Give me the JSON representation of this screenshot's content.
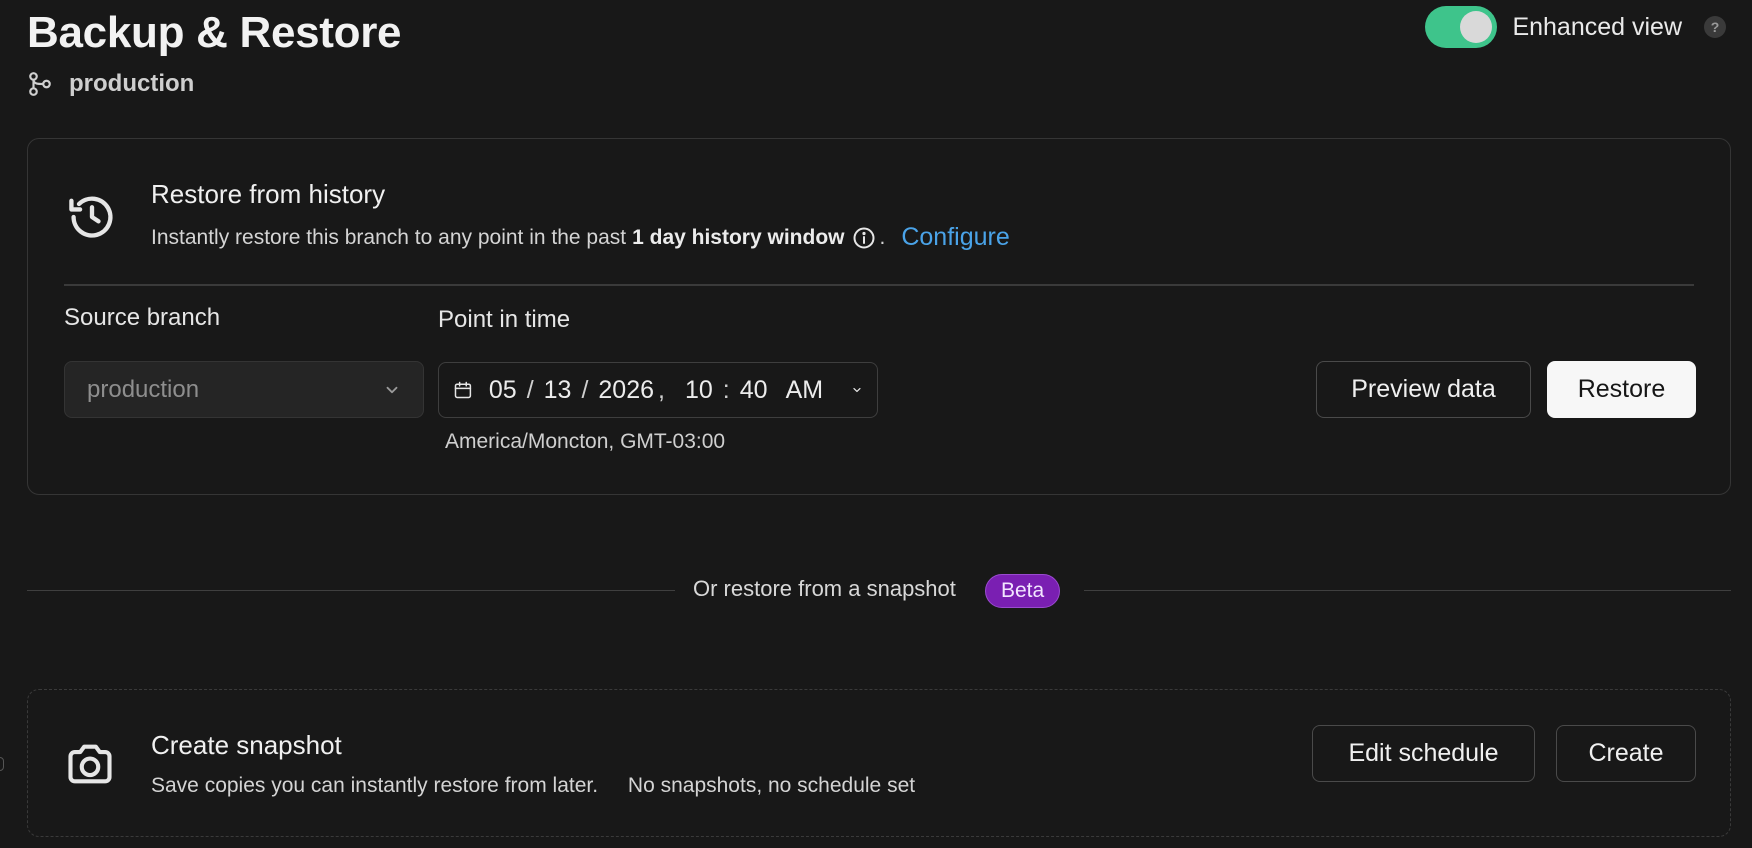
{
  "header": {
    "title": "Backup & Restore",
    "branch": "production",
    "enhanced_view_label": "Enhanced view",
    "enhanced_view_on": true,
    "help_glyph": "?",
    "toggle_color": "#3ec48b"
  },
  "history": {
    "title": "Restore from history",
    "description": "Instantly restore this branch to any point in the past",
    "window_text": "1 day history window",
    "period": ".",
    "configure_label": "Configure",
    "source_branch_label": "Source branch",
    "source_branch_value": "production",
    "point_in_time_label": "Point in time",
    "date": {
      "month": "05",
      "day": "13",
      "year": "2026",
      "hour": "10",
      "minute": "40",
      "ampm": "AM",
      "date_sep": "/",
      "date_time_sep": ",",
      "time_sep": ":"
    },
    "timezone": "America/Moncton, GMT-03:00",
    "preview_label": "Preview data",
    "restore_label": "Restore"
  },
  "snapshot_divider": {
    "text": "Or restore from a snapshot",
    "badge": "Beta",
    "badge_color": "#7a1fb2"
  },
  "snapshot": {
    "title": "Create snapshot",
    "description": "Save copies you can instantly restore from later.",
    "status": "No snapshots, no schedule set",
    "edit_schedule_label": "Edit schedule",
    "create_label": "Create"
  },
  "icons": {
    "branch": "branch-icon",
    "history": "history-icon",
    "info": "info-icon",
    "chevron": "chevron-down-icon",
    "calendar": "calendar-icon",
    "camera": "camera-icon"
  },
  "colors": {
    "background": "#181818",
    "link": "#4aa3e8"
  }
}
